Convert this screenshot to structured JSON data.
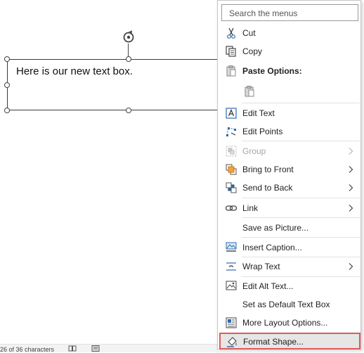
{
  "document": {
    "textbox_text": "Here is our new text box."
  },
  "statusbar": {
    "text": "26 of 36 characters"
  },
  "menu": {
    "search": {
      "placeholder": "Search the menus"
    },
    "items": [
      {
        "label": "Cut",
        "icon": "scissors-icon"
      },
      {
        "label": "Copy",
        "icon": "copy-icon"
      },
      {
        "label": "Paste Options:",
        "icon": "paste-icon"
      },
      {
        "label": "",
        "icon": "paste-keep-format-icon"
      },
      {
        "label": "Edit Text",
        "icon": "edit-text-icon"
      },
      {
        "label": "Edit Points",
        "icon": "edit-points-icon"
      },
      {
        "label": "Group",
        "icon": "group-icon",
        "disabled": true
      },
      {
        "label": "Bring to Front",
        "icon": "bring-to-front-icon"
      },
      {
        "label": "Send to Back",
        "icon": "send-to-back-icon"
      },
      {
        "label": "Link",
        "icon": "link-icon"
      },
      {
        "label": "Save as Picture...",
        "icon": ""
      },
      {
        "label": "Insert Caption...",
        "icon": "insert-caption-icon"
      },
      {
        "label": "Wrap Text",
        "icon": "wrap-text-icon"
      },
      {
        "label": "Edit Alt Text...",
        "icon": "alt-text-icon"
      },
      {
        "label": "Set as Default Text Box",
        "icon": ""
      },
      {
        "label": "More Layout Options...",
        "icon": "layout-options-icon"
      },
      {
        "label": "Format Shape...",
        "icon": "format-shape-icon"
      }
    ]
  },
  "colors": {
    "highlight_border": "#e05a5a",
    "icon_blue": "#2b6cb0"
  }
}
